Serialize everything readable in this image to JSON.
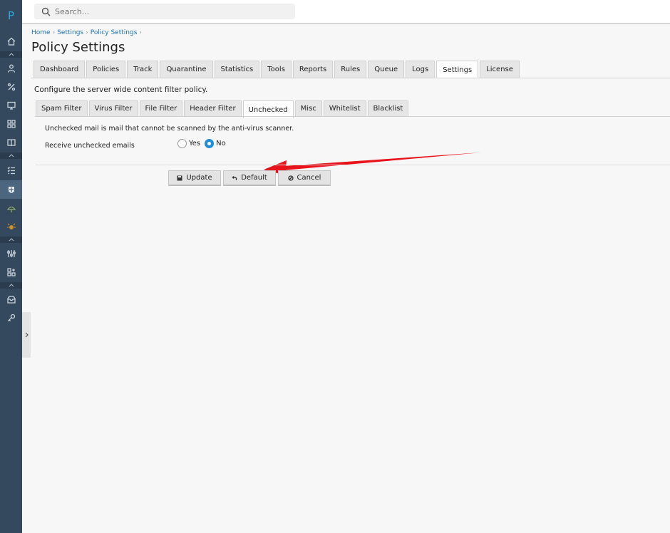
{
  "app": {
    "logo_letter": "P"
  },
  "search": {
    "placeholder": "Search..."
  },
  "breadcrumb": [
    "Home",
    "Settings",
    "Policy Settings"
  ],
  "page": {
    "title": "Policy Settings"
  },
  "main_tabs": [
    {
      "label": "Dashboard",
      "active": false
    },
    {
      "label": "Policies",
      "active": false
    },
    {
      "label": "Track",
      "active": false
    },
    {
      "label": "Quarantine",
      "active": false
    },
    {
      "label": "Statistics",
      "active": false
    },
    {
      "label": "Tools",
      "active": false
    },
    {
      "label": "Reports",
      "active": false
    },
    {
      "label": "Rules",
      "active": false
    },
    {
      "label": "Queue",
      "active": false
    },
    {
      "label": "Logs",
      "active": false
    },
    {
      "label": "Settings",
      "active": true
    },
    {
      "label": "License",
      "active": false
    }
  ],
  "description": "Configure the server wide content filter policy.",
  "sub_tabs": [
    {
      "label": "Spam Filter",
      "active": false
    },
    {
      "label": "Virus Filter",
      "active": false
    },
    {
      "label": "File Filter",
      "active": false
    },
    {
      "label": "Header Filter",
      "active": false
    },
    {
      "label": "Unchecked",
      "active": true
    },
    {
      "label": "Misc",
      "active": false
    },
    {
      "label": "Whitelist",
      "active": false
    },
    {
      "label": "Blacklist",
      "active": false
    }
  ],
  "unchecked": {
    "info": "Unchecked mail is mail that cannot be scanned by the anti-virus scanner.",
    "field_label": "Receive unchecked emails",
    "options": [
      {
        "label": "Yes",
        "checked": false
      },
      {
        "label": "No",
        "checked": true
      }
    ]
  },
  "buttons": {
    "update": "Update",
    "default": "Default",
    "cancel": "Cancel"
  },
  "colors": {
    "sidebar": "#34495e",
    "accent": "#1e8ed8",
    "arrow": "#e8141b",
    "link": "#1a73c0"
  },
  "sidebar_icons": [
    "home-icon",
    "user-icon",
    "percent-icon",
    "monitor-icon",
    "grid-icon",
    "book-icon",
    "checklist-icon",
    "shield-icon",
    "umbrella-icon",
    "bug-icon",
    "sliders-icon",
    "apps-icon",
    "inbox-icon",
    "key-icon"
  ]
}
